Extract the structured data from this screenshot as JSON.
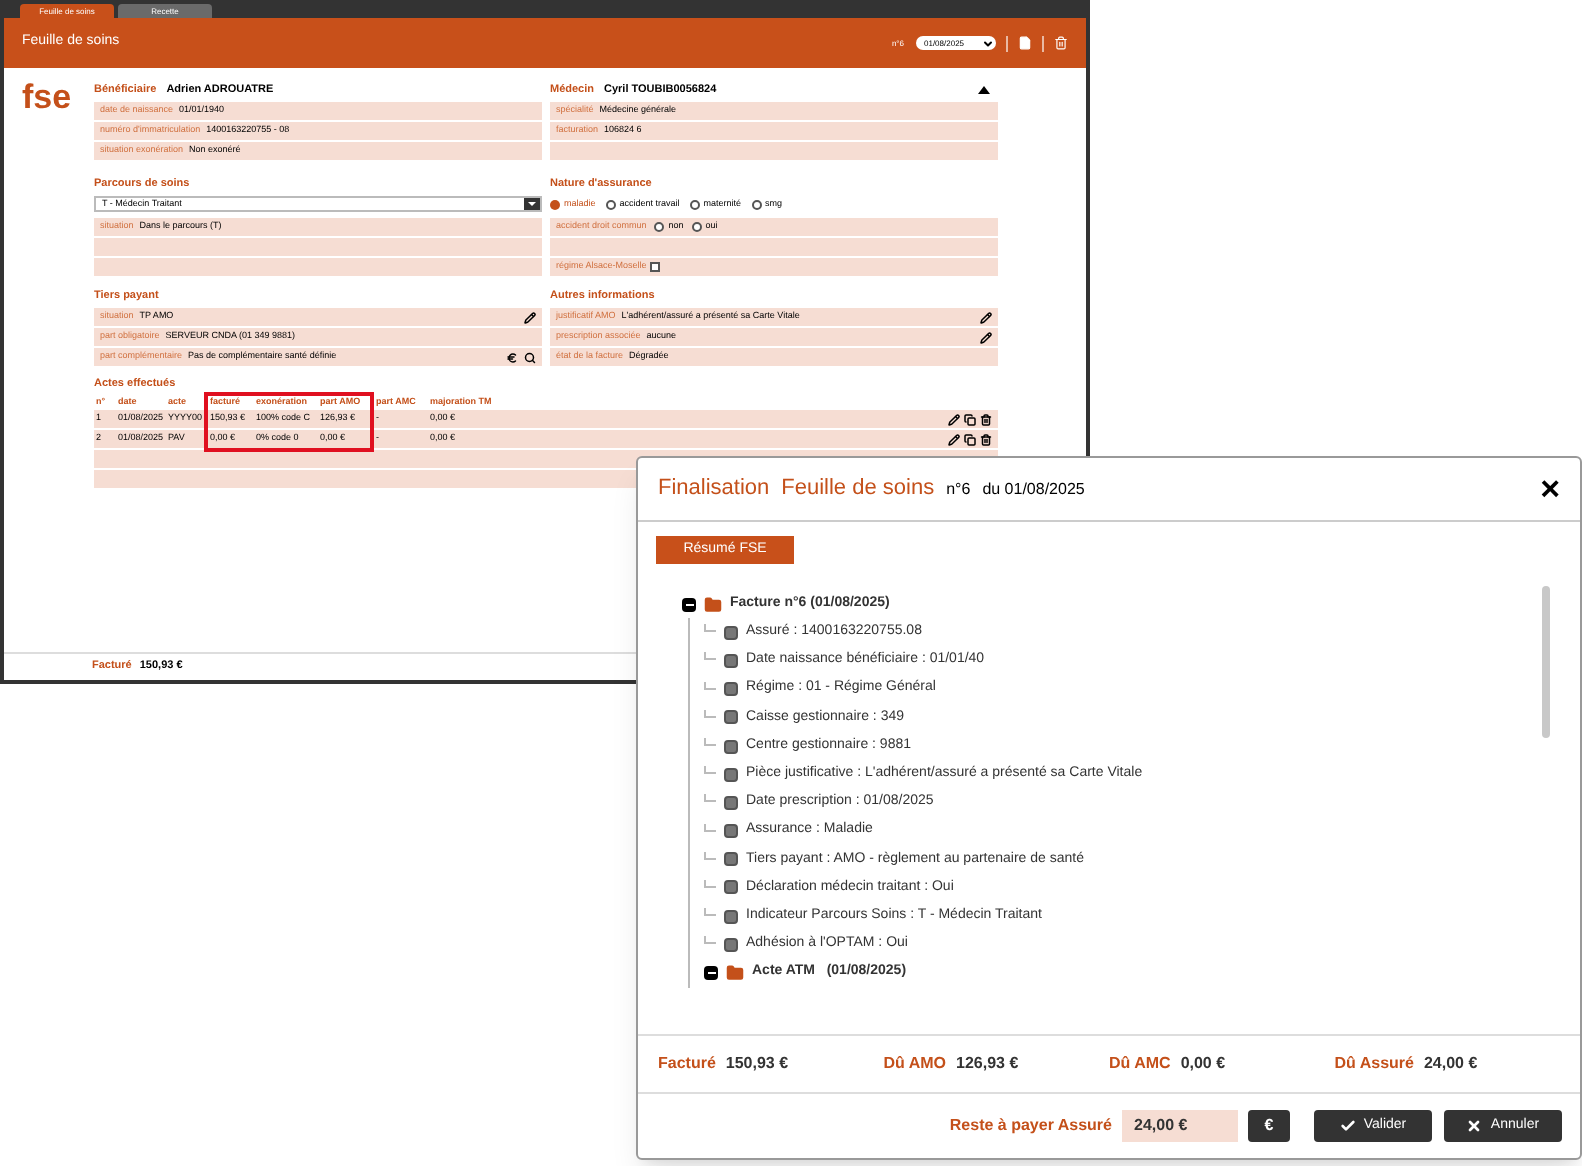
{
  "tabs": [
    {
      "label": "Feuille de soins",
      "selected": true
    },
    {
      "label": "Recette",
      "selected": false
    }
  ],
  "header": {
    "title": "Feuille de soins",
    "number": "n°6",
    "date": "01/08/2025"
  },
  "logo": "fse",
  "beneficiaire": {
    "label": "Bénéficiaire",
    "name": "Adrien ADROUATRE",
    "fields": [
      {
        "label": "date de naissance",
        "value": "01/01/1940"
      },
      {
        "label": "numéro d'immatriculation",
        "value": "1400163220755 - 08"
      },
      {
        "label": "situation exonération",
        "value": "Non exonéré"
      }
    ]
  },
  "medecin": {
    "label": "Médecin",
    "name": "Cyril TOUBIB0056824",
    "fields": [
      {
        "label": "spécialité",
        "value": "Médecine générale"
      },
      {
        "label": "facturation",
        "value": "106824 6"
      }
    ]
  },
  "parcours": {
    "title": "Parcours de soins",
    "select": "T - Médecin Traitant",
    "fields": [
      {
        "label": "situation",
        "value": "Dans le parcours (T)"
      }
    ]
  },
  "nature": {
    "title": "Nature d'assurance",
    "options": [
      {
        "label": "maladie",
        "selected": true
      },
      {
        "label": "accident travail",
        "selected": false
      },
      {
        "label": "maternité",
        "selected": false
      },
      {
        "label": "smg",
        "selected": false
      }
    ],
    "accident": {
      "label": "accident droit commun",
      "options": [
        {
          "label": "non",
          "selected": false
        },
        {
          "label": "oui",
          "selected": false
        }
      ]
    },
    "alsace": {
      "label": "régime Alsace-Moselle",
      "checked": false
    }
  },
  "tiers": {
    "title": "Tiers payant",
    "fields": [
      {
        "kind": "editable",
        "label": "situation",
        "value": "TP AMO"
      },
      {
        "kind": "plain",
        "label": "part obligatoire",
        "value": "SERVEUR CNDA  (01 349 9881)"
      },
      {
        "kind": "payment",
        "label": "part complémentaire",
        "value": "Pas de complémentaire santé définie"
      }
    ]
  },
  "autres": {
    "title": "Autres informations",
    "fields": [
      {
        "kind": "editable",
        "label": "justificatif AMO",
        "value": "L'adhérent/assuré a présenté sa Carte Vitale"
      },
      {
        "kind": "editable",
        "label": "prescription associée",
        "value": "aucune"
      },
      {
        "kind": "plain",
        "label": "état de la facture",
        "value": "Dégradée"
      }
    ]
  },
  "actes": {
    "title": "Actes effectués",
    "columns": [
      {
        "label": "n°",
        "highlighted": false
      },
      {
        "label": "date",
        "highlighted": false
      },
      {
        "label": "acte",
        "highlighted": false
      },
      {
        "label": "facturé",
        "highlighted": true
      },
      {
        "label": "exonération",
        "highlighted": true
      },
      {
        "label": "part AMO",
        "highlighted": true
      },
      {
        "label": "part AMC",
        "highlighted": false
      },
      {
        "label": "majoration TM",
        "highlighted": false
      }
    ],
    "rows": [
      {
        "cells": [
          "1",
          "01/08/2025",
          "YYYY00",
          "150,93 €",
          "100% code C",
          "126,93 €",
          "-",
          "0,00 €"
        ]
      },
      {
        "cells": [
          "2",
          "01/08/2025",
          "PAV",
          "0,00 €",
          "0% code 0",
          "0,00 €",
          "-",
          "0,00 €"
        ]
      }
    ]
  },
  "footer": {
    "label": "Facturé",
    "value": "150,93 €"
  },
  "dialog": {
    "title": "Finalisation",
    "subtitle": "Feuille de soins",
    "number": "n°6",
    "date": "du 01/08/2025",
    "close": "×",
    "summary_button": "Résumé FSE",
    "tree": [
      {
        "kind": "folder",
        "label": "Facture n°6 (01/08/2025)",
        "expanded": true,
        "children": [
          {
            "kind": "field",
            "label": "Assuré : 1400163220755.08"
          },
          {
            "kind": "field",
            "label": "Date naissance bénéficiaire : 01/01/40"
          },
          {
            "kind": "field",
            "label": "Régime : 01 - Régime Général"
          },
          {
            "kind": "field",
            "label": "Caisse gestionnaire : 349"
          },
          {
            "kind": "field",
            "label": "Centre gestionnaire : 9881"
          },
          {
            "kind": "field",
            "label": "Pièce justificative : L'adhérent/assuré a présenté sa Carte Vitale"
          },
          {
            "kind": "field",
            "label": "Date prescription : 01/08/2025"
          },
          {
            "kind": "field",
            "label": "Assurance : Maladie"
          },
          {
            "kind": "field",
            "label": "Tiers payant : AMO - règlement au partenaire de santé"
          },
          {
            "kind": "field",
            "label": "Déclaration médecin traitant : Oui"
          },
          {
            "kind": "field",
            "label": "Indicateur Parcours Soins : T - Médecin Traitant"
          },
          {
            "kind": "field",
            "label": "Adhésion à l'OPTAM : Oui"
          },
          {
            "kind": "folder",
            "label": "Acte ATM   (01/08/2025)",
            "expanded": true
          }
        ]
      }
    ],
    "totals": [
      {
        "label": "Facturé",
        "value": "150,93 €"
      },
      {
        "label": "Dû AMO",
        "value": "126,93 €"
      },
      {
        "label": "Dû AMC",
        "value": "0,00 €"
      },
      {
        "label": "Dû Assuré",
        "value": "24,00 €"
      }
    ],
    "reste": {
      "label": "Reste à payer Assuré",
      "value": "24,00 €"
    },
    "euro_button": "€",
    "validate_button": "Valider",
    "cancel_button": "Annuler"
  }
}
